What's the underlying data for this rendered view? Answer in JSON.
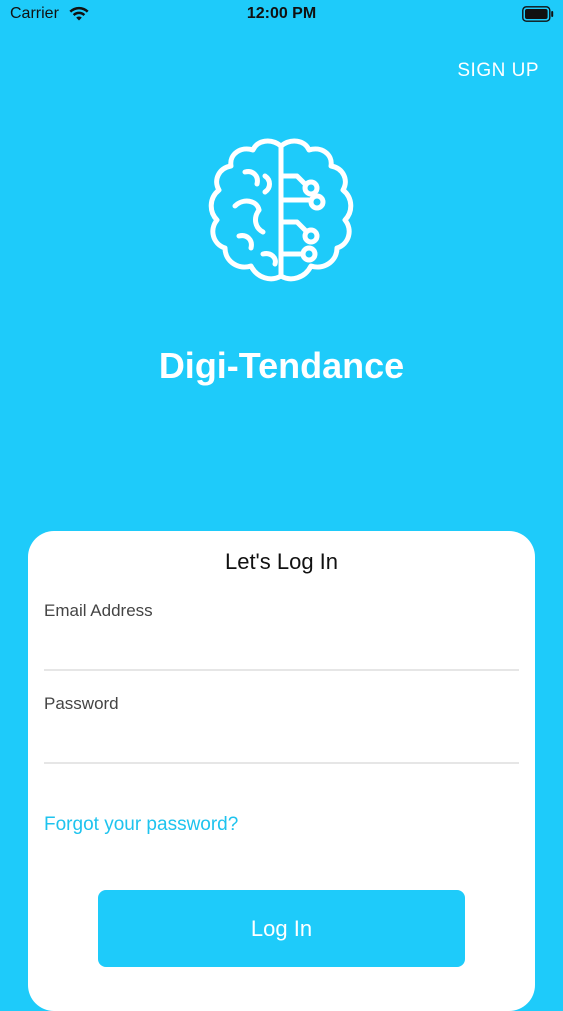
{
  "status_bar": {
    "carrier": "Carrier",
    "time": "12:00 PM",
    "wifi_icon": "wifi-icon",
    "battery_icon": "battery-icon"
  },
  "header": {
    "signup_label": "SIGN UP"
  },
  "branding": {
    "logo_icon": "brain-circuit-icon",
    "app_name": "Digi-Tendance"
  },
  "login_card": {
    "title": "Let's Log In",
    "email": {
      "label": "Email Address",
      "value": ""
    },
    "password": {
      "label": "Password",
      "value": ""
    },
    "forgot_password_label": "Forgot your password?",
    "login_button_label": "Log In"
  },
  "colors": {
    "background": "#1ecbfa",
    "card": "#ffffff",
    "link": "#1ec3ee",
    "button": "#1ecbfa"
  }
}
